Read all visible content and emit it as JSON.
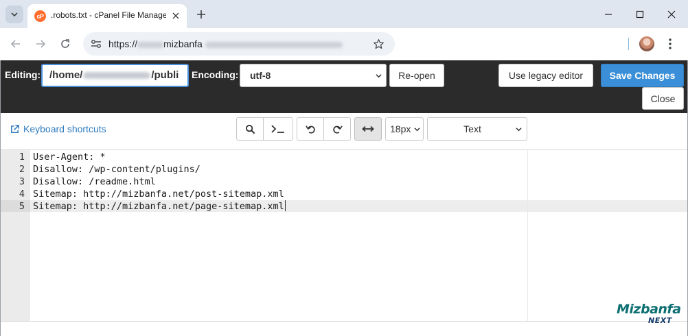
{
  "browser": {
    "tab_title": ".robots.txt - cPanel File Manage",
    "favicon_text": "cP",
    "url_prefix": "https://",
    "url_visible": "mizbanfa"
  },
  "editor_header": {
    "editing_label": "Editing:",
    "path_start": "/home/",
    "path_end": "/publi",
    "encoding_label": "Encoding:",
    "encoding_value": "utf-8",
    "reopen_label": "Re-open",
    "legacy_label": "Use legacy editor",
    "save_label": "Save Changes",
    "close_label": "Close"
  },
  "toolbar": {
    "keyboard_shortcuts": "Keyboard shortcuts",
    "font_size": "18px",
    "mode": "Text"
  },
  "code": {
    "lines": [
      {
        "num": "1",
        "text": "User-Agent: *"
      },
      {
        "num": "2",
        "text": "Disallow: /wp-content/plugins/"
      },
      {
        "num": "3",
        "text": "Disallow: /readme.html"
      },
      {
        "num": "4",
        "text": "Sitemap: http://mizbanfa.net/post-sitemap.xml"
      },
      {
        "num": "5",
        "text": "Sitemap: http://mizbanfa.net/page-sitemap.xml"
      }
    ],
    "active_line": 5
  },
  "watermark": {
    "brand": "Mizbanfa",
    "sub": "NEXT"
  },
  "colors": {
    "save_button": "#3a8fd8",
    "header_bg": "#2b2b2b",
    "link": "#2e7bbf",
    "brand": "#0e6f73"
  }
}
